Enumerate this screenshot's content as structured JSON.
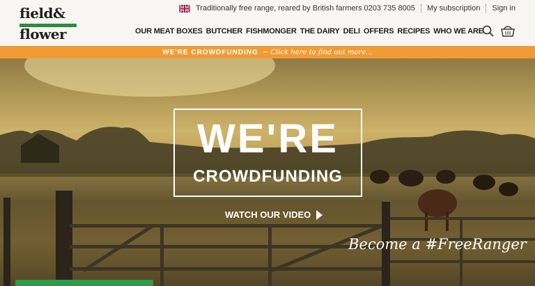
{
  "brand": {
    "line1": "field&",
    "line2": "flower",
    "accent_color": "#2e8b3d"
  },
  "header": {
    "tagline": "Traditionally free range, reared by British farmers",
    "phone": "0203 735 8005",
    "subscription": "My subscription",
    "signin": "Sign in"
  },
  "nav": {
    "items": [
      "OUR MEAT BOXES",
      "BUTCHER",
      "FISHMONGER",
      "THE DAIRY",
      "DELI",
      "OFFERS",
      "RECIPES",
      "WHO WE ARE"
    ]
  },
  "banner": {
    "text": "WE'RE CROWDFUNDING",
    "link": "~ Click here to find out more...",
    "color": "#f19b35"
  },
  "hero": {
    "headline": "WE'RE",
    "subheadline": "CROWDFUNDING",
    "watch_label": "WATCH OUR VIDEO",
    "tagline": "Become a #FreeRanger"
  },
  "icons": {
    "search": "search-icon",
    "basket": "basket-icon",
    "flag": "uk-flag-icon",
    "play": "play-icon"
  }
}
